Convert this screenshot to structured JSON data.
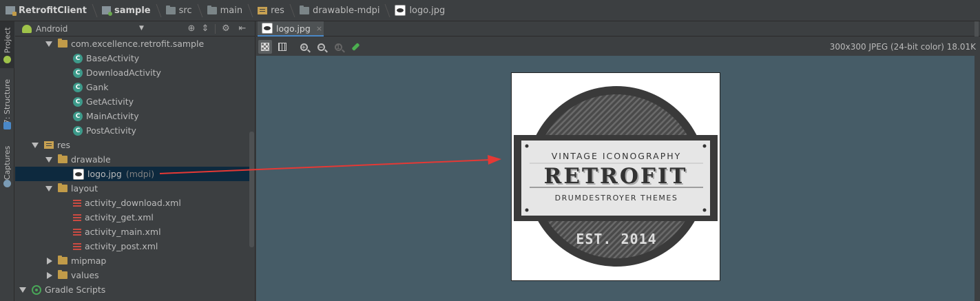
{
  "breadcrumb": [
    {
      "label": "RetrofitClient",
      "icon": "project-icon",
      "bold": true
    },
    {
      "label": "sample",
      "icon": "module-icon",
      "bold": true
    },
    {
      "label": "src",
      "icon": "folder-icon",
      "bold": false
    },
    {
      "label": "main",
      "icon": "folder-icon",
      "bold": false
    },
    {
      "label": "res",
      "icon": "res-folder-icon",
      "bold": false
    },
    {
      "label": "drawable-mdpi",
      "icon": "folder-icon",
      "bold": false
    },
    {
      "label": "logo.jpg",
      "icon": "image-file-icon",
      "bold": false
    }
  ],
  "left_strip": {
    "tabs": [
      "1: Project",
      "7: Structure",
      "Captures"
    ]
  },
  "project_panel": {
    "view_mode": "Android",
    "tree": [
      {
        "label": "com.excellence.retrofit.sample",
        "type": "package",
        "expanded": true,
        "indent": 2
      },
      {
        "label": "BaseActivity",
        "type": "class",
        "indent": 4
      },
      {
        "label": "DownloadActivity",
        "type": "class",
        "indent": 4
      },
      {
        "label": "Gank",
        "type": "class",
        "indent": 4
      },
      {
        "label": "GetActivity",
        "type": "class",
        "indent": 4
      },
      {
        "label": "MainActivity",
        "type": "class",
        "indent": 4
      },
      {
        "label": "PostActivity",
        "type": "class",
        "indent": 4
      },
      {
        "label": "res",
        "type": "res",
        "expanded": true,
        "indent": 1
      },
      {
        "label": "drawable",
        "type": "folder",
        "expanded": true,
        "indent": 2
      },
      {
        "label": "logo.jpg",
        "suffix": "(mdpi)",
        "type": "image",
        "indent": 4,
        "selected": true
      },
      {
        "label": "layout",
        "type": "folder",
        "expanded": true,
        "indent": 2
      },
      {
        "label": "activity_download.xml",
        "type": "xml",
        "indent": 4
      },
      {
        "label": "activity_get.xml",
        "type": "xml",
        "indent": 4
      },
      {
        "label": "activity_main.xml",
        "type": "xml",
        "indent": 4
      },
      {
        "label": "activity_post.xml",
        "type": "xml",
        "indent": 4
      },
      {
        "label": "mipmap",
        "type": "folder",
        "expanded": false,
        "indent": 2
      },
      {
        "label": "values",
        "type": "folder",
        "expanded": false,
        "indent": 2
      },
      {
        "label": "Gradle Scripts",
        "type": "gradle",
        "expanded": true,
        "indent": 0
      }
    ]
  },
  "editor": {
    "tab_label": "logo.jpg",
    "close_symbol": "×",
    "image_info": "300x300 JPEG (24-bit color) 18.01K"
  },
  "logo": {
    "line1": "VINTAGE ICONOGRAPHY",
    "line2": "RETROFIT",
    "line3": "DRUMDESTROYER THEMES",
    "line4": "EST. 2014"
  },
  "colors": {
    "canvas_bg": "#465c67",
    "selection": "#0d293e",
    "annotation_arrow": "#e53935",
    "class_icon": "#3d9a8a"
  }
}
